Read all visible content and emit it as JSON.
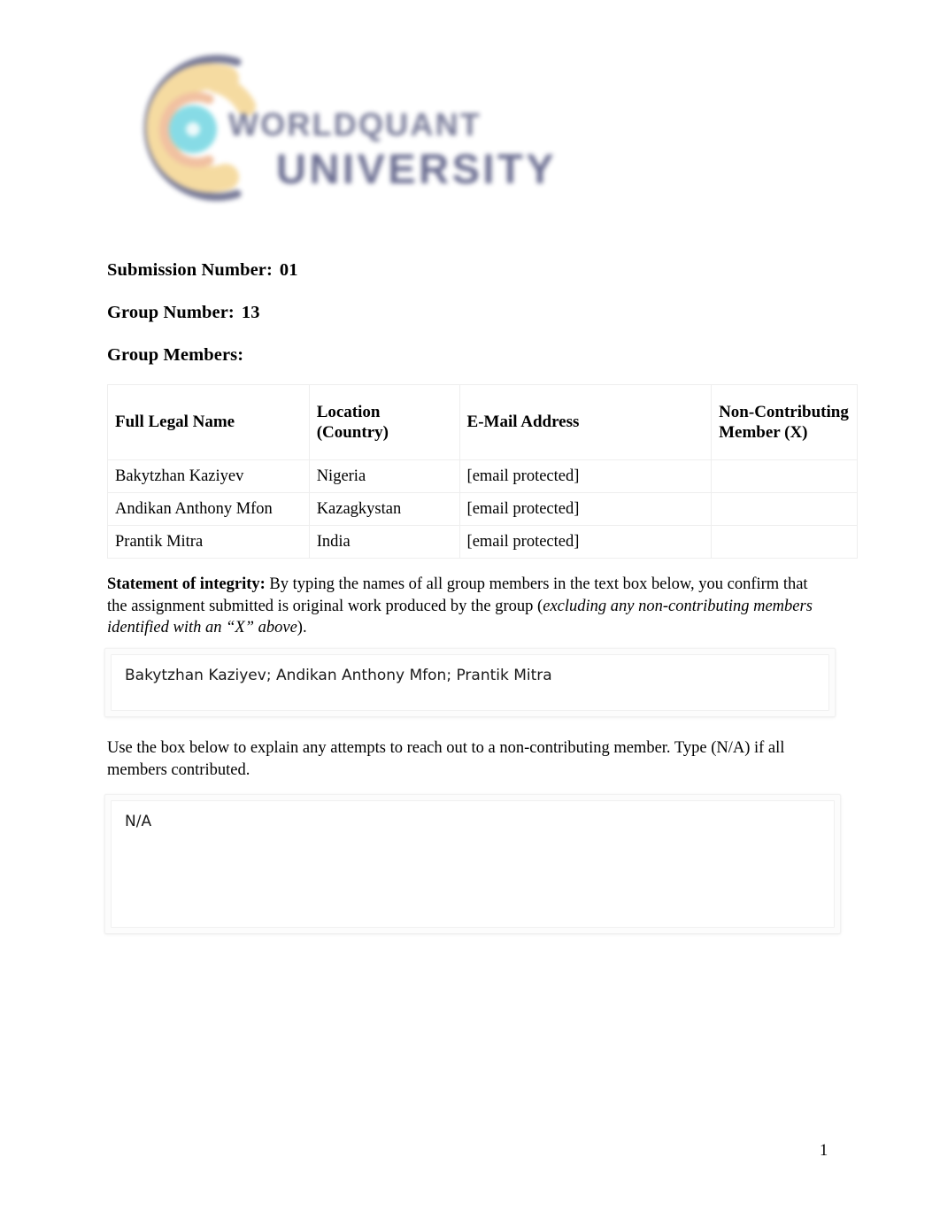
{
  "document": {
    "logo": {
      "name": "worldquant-university-logo",
      "wordmark_line1": "WORLDQUANT",
      "wordmark_line2": "UNIVERSITY",
      "colors": {
        "outer_ring": "#6d7090",
        "gold_ring": "#f5d89a",
        "peach_ring": "#f0bc9a",
        "center": "#7dd9e4",
        "wordmark": "#6d7090"
      }
    },
    "meta": {
      "submission_label": "Submission Number:",
      "submission_value": "01",
      "group_label": "Group Number:",
      "group_value": "13",
      "members_label": "Group Members:"
    },
    "members_table": {
      "headers": [
        "Full Legal Name",
        "Location (Country)",
        "E-Mail Address",
        "Non-Contributing Member (X)"
      ],
      "rows": [
        {
          "full_legal_name": "Bakytzhan Kaziyev",
          "location": "Nigeria",
          "email": "[email protected]",
          "non_contributing": ""
        },
        {
          "full_legal_name": "Andikan Anthony Mfon",
          "location": "Kazagkystan",
          "email": "[email protected]",
          "non_contributing": ""
        },
        {
          "full_legal_name": "Prantik Mitra",
          "location": "India",
          "email": "[email protected]",
          "non_contributing": ""
        }
      ]
    },
    "integrity": {
      "label": "Statement of integrity:",
      "body": " By typing the names of all group members in the text box below, you confirm that the assignment submitted is original work produced by the group (",
      "italic": "excluding any non-contributing members identified with an “X” above",
      "tail": ").",
      "textbox_value": "Bakytzhan Kaziyev; Andikan Anthony Mfon; Prantik Mitra"
    },
    "explain": {
      "instruction": "Use the box below to explain any attempts to reach out to a non-contributing member. Type (N/A) if all members contributed.",
      "textbox_value": "N/A"
    },
    "footer": {
      "page_number": "1"
    }
  }
}
